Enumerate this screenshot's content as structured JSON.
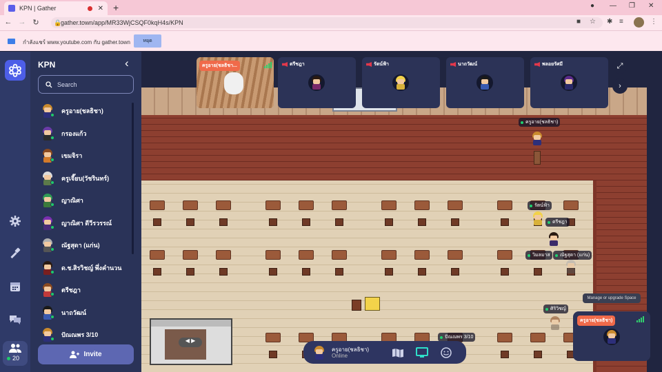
{
  "browser": {
    "tab_title": "KPN | Gather",
    "url": "gather.town/app/MR33WjCSQF0kqH4s/KPN",
    "share_notice": "กำลังแชร์ www.youtube.com กับ gather.town",
    "stop_label": "หยุด",
    "minimize": "—",
    "restore": "❐",
    "close": "✕"
  },
  "panel": {
    "title": "KPN",
    "search_placeholder": "Search",
    "invite_label": "Invite",
    "people_count": "20",
    "participants": [
      {
        "name": "ครูอาย(ชลธิชา)",
        "hair": "#c98a2e",
        "shirt": "#2d2f7a"
      },
      {
        "name": "กรองแก้ว",
        "hair": "#6a3ba6",
        "shirt": "#2c2c2c"
      },
      {
        "name": "เขมจิรา",
        "hair": "#8a4a20",
        "shirt": "#d27a2a"
      },
      {
        "name": "ครูเจี๊ยบ(วัชรินทร์)",
        "hair": "#dcdcdc",
        "shirt": "#5c7a4a"
      },
      {
        "name": "ญาณิศา",
        "hair": "#2f9a55",
        "shirt": "#3b7a3b"
      },
      {
        "name": "ญาณิศา ดีวีรวรรณ์",
        "hair": "#7a2fb0",
        "shirt": "#4b2b7a"
      },
      {
        "name": "ณัฐสุดา (แก่น)",
        "hair": "#b0b0b0",
        "shirt": "#555555"
      },
      {
        "name": "ด.ช.สิรวิชญ์ พึ่งคำนวน",
        "hair": "#2a1a12",
        "shirt": "#7a1f1f"
      },
      {
        "name": "ตรีชฎา",
        "hair": "#8a4a20",
        "shirt": "#c23a3a"
      },
      {
        "name": "นาถวัฒน์",
        "hair": "#1a1a1a",
        "shirt": "#3a5ab0"
      },
      {
        "name": "ปัณณพร 3/10",
        "hair": "#c98a2e",
        "shirt": "#2d2f7a"
      }
    ]
  },
  "video_tiles": [
    {
      "name": "ครูอาย(ชลธิชา...",
      "self": true
    },
    {
      "name": "ตรีชฎา"
    },
    {
      "name": "รัตน์ฟ้า"
    },
    {
      "name": "นาถวัฒน์"
    },
    {
      "name": "พลอยรัศมี"
    }
  ],
  "map_labels": {
    "teacher": "ครูอาย(ชลธิชา)",
    "rat": "รัตน์ฟ้า",
    "tri": "ตรีชฎา",
    "wim": "วิมลมาส",
    "nat": "ณัฐสุดา (แก่น)",
    "siri": "ศิริวิชญ์",
    "pan": "ปัณณพร 3/10"
  },
  "toolbar": {
    "name": "ครูอาย(ชลธิชา)",
    "status": "Online"
  },
  "self_tile": {
    "name": "ครูอาย(ชลธิชา)"
  },
  "tooltip": "Manage or upgrade Space",
  "colors": {
    "accent": "#5d67b2",
    "online": "#1fc96a",
    "alert": "#f06a4a"
  }
}
